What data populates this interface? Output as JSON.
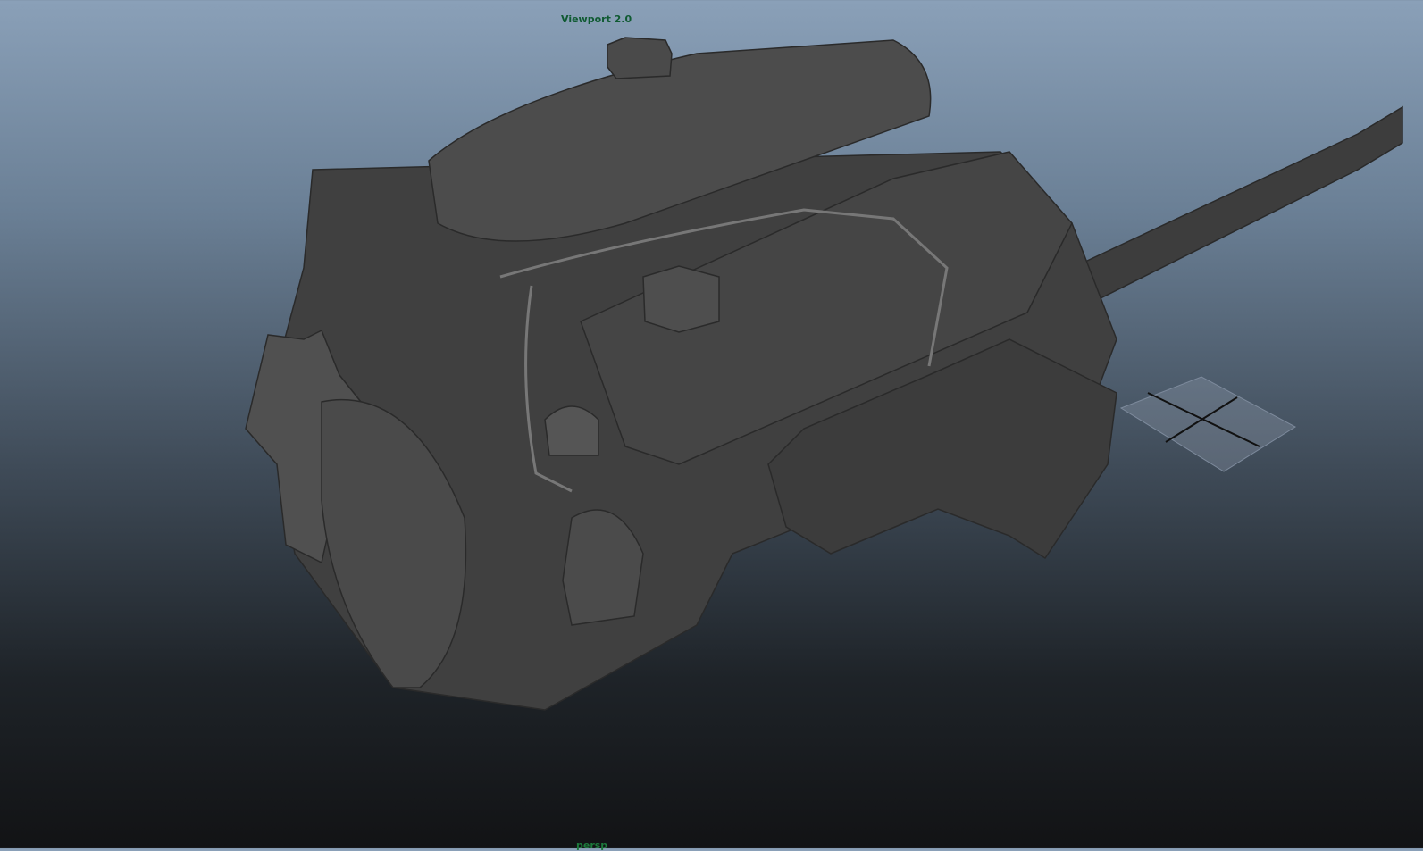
{
  "viewport": {
    "renderer_label": "Viewport 2.0",
    "camera_label": "persp"
  },
  "colors": {
    "label": "#0f5a32",
    "mesh": "#4a4a4a",
    "grid": "#7a8596"
  }
}
